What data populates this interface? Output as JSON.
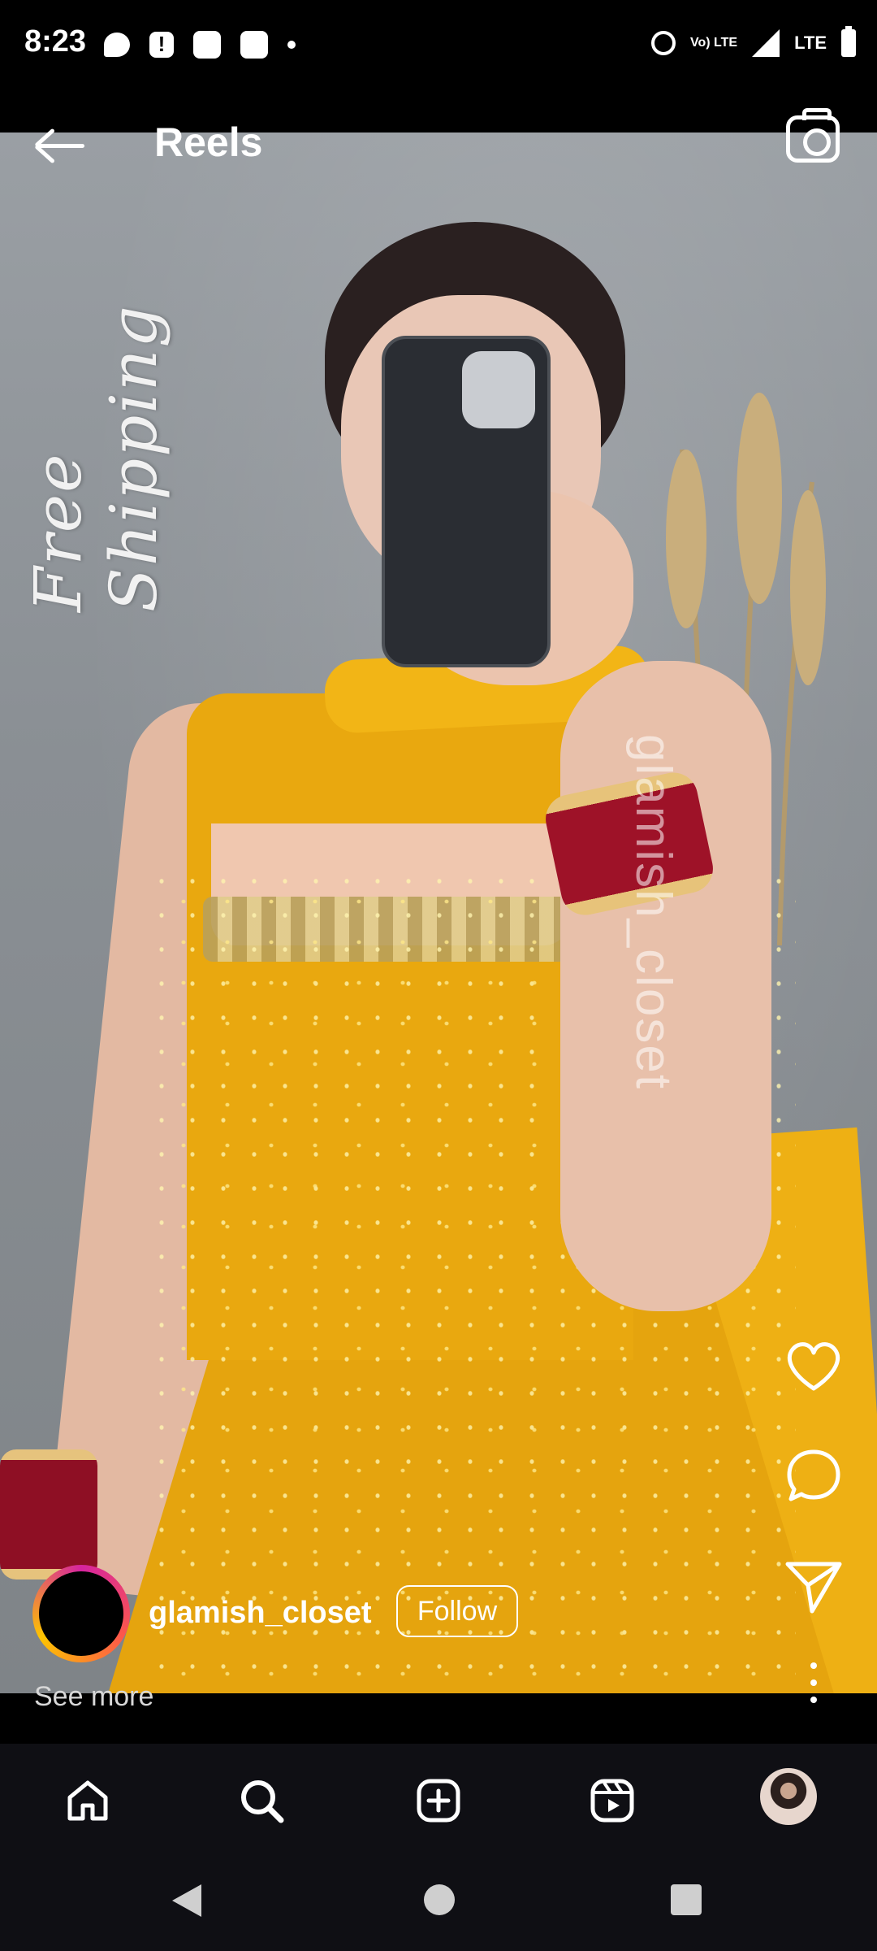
{
  "status_bar": {
    "time": "8:23",
    "icons_left": [
      "chat-bubble-icon",
      "alert-icon",
      "notification-icon",
      "notification-icon",
      "dot-icon"
    ],
    "volte": "Vo) LTE",
    "network": "LTE",
    "icons_right": [
      "alarm-icon",
      "volte-icon",
      "signal-icon",
      "lte-signal-icon",
      "battery-icon"
    ]
  },
  "header": {
    "title": "Reels",
    "back_icon": "arrow-left-icon",
    "camera_icon": "camera-icon"
  },
  "video": {
    "overlay_text": "Free Shipping",
    "watermark": "glamish_closet"
  },
  "actions": {
    "like_icon": "heart-icon",
    "comment_icon": "comment-icon",
    "share_icon": "send-icon",
    "more_icon": "more-vertical-icon"
  },
  "author": {
    "username": "glamish_closet",
    "follow_label": "Follow",
    "see_more": "See more",
    "ring_colors": [
      "#d6249f",
      "#fd5949",
      "#fdc400"
    ]
  },
  "bottom_nav": {
    "items": [
      "home-icon",
      "search-icon",
      "create-icon",
      "reels-icon",
      "profile-avatar"
    ],
    "active": "search-icon"
  },
  "system_nav": {
    "items": [
      "back-icon",
      "home-circle-icon",
      "recents-icon"
    ]
  }
}
